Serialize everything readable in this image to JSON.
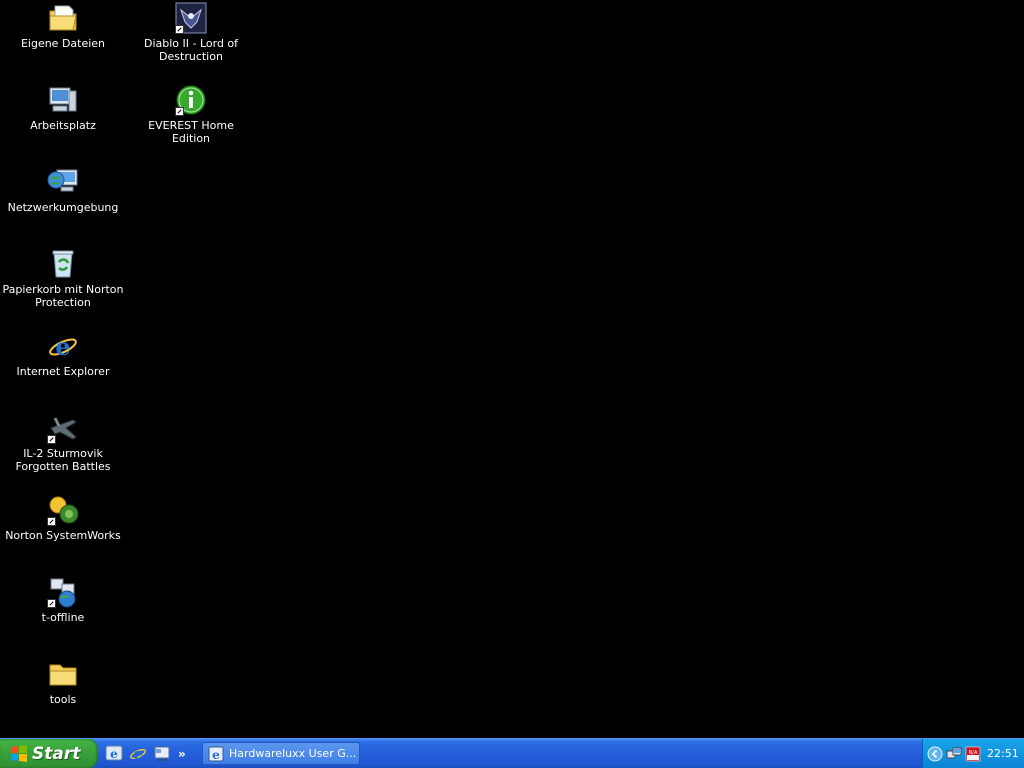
{
  "desktop": {
    "icons": [
      {
        "label": "Eigene Dateien"
      },
      {
        "label": "Arbeitsplatz"
      },
      {
        "label": "Netzwerkumgebung"
      },
      {
        "label": "Papierkorb mit Norton Protection"
      },
      {
        "label": "Internet Explorer"
      },
      {
        "label": "IL-2 Sturmovik Forgotten Battles"
      },
      {
        "label": "Norton SystemWorks"
      },
      {
        "label": "t-offline"
      },
      {
        "label": "tools"
      },
      {
        "label": "Diablo II - Lord of Destruction"
      },
      {
        "label": "EVEREST Home Edition"
      }
    ]
  },
  "taskbar": {
    "start_label": "Start",
    "quicklaunch_overflow": "»",
    "task": {
      "label": "Hardwareluxx User G..."
    },
    "clock": "22:51"
  },
  "colors": {
    "desktop_background": "#000000",
    "taskbar_blue": "#245edb",
    "start_green": "#3aa33c",
    "tray_blue": "#1196e0"
  }
}
